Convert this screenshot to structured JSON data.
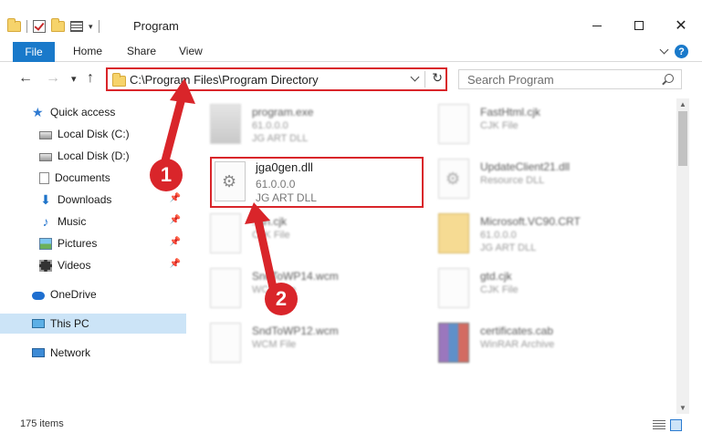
{
  "window": {
    "title": "Program",
    "controls": {
      "minimize": "",
      "maximize": "",
      "close": "✕"
    }
  },
  "ribbon": {
    "tabs": [
      {
        "label": "File"
      },
      {
        "label": "Home"
      },
      {
        "label": "Share"
      },
      {
        "label": "View"
      }
    ],
    "help": "?"
  },
  "nav": {
    "back": "←",
    "forward": "→",
    "recent": "▾",
    "up": "↑",
    "address": "C:\\Program Files\\Program Directory",
    "refresh": "↻",
    "search_placeholder": "Search Program"
  },
  "sidebar": {
    "items": [
      {
        "label": "Quick access",
        "icon": "star-icon"
      },
      {
        "label": "Local Disk (C:)",
        "icon": "disk-icon"
      },
      {
        "label": "Local Disk (D:)",
        "icon": "disk-icon"
      },
      {
        "label": "Documents",
        "icon": "documents-icon",
        "pinned": true
      },
      {
        "label": "Downloads",
        "icon": "downloads-icon",
        "pinned": true
      },
      {
        "label": "Music",
        "icon": "music-icon",
        "pinned": true
      },
      {
        "label": "Pictures",
        "icon": "pictures-icon",
        "pinned": true
      },
      {
        "label": "Videos",
        "icon": "videos-icon",
        "pinned": true
      },
      {
        "label": "OneDrive",
        "icon": "onedrive-icon"
      },
      {
        "label": "This PC",
        "icon": "this-pc-icon",
        "selected": true
      },
      {
        "label": "Network",
        "icon": "network-icon"
      }
    ],
    "pin_glyph": "📌"
  },
  "files": [
    {
      "name": "program.exe",
      "meta1": "61.0.0.0",
      "meta2": "JG ART DLL",
      "type": "exe"
    },
    {
      "name": "FastHtml.cjk",
      "meta1": "CJK File",
      "meta2": "",
      "type": "doc"
    },
    {
      "name": "UpdateClient21.dll",
      "meta1": "Resource DLL",
      "meta2": "",
      "type": "dll"
    },
    {
      "name": "..an.cjk",
      "meta1": "CJK File",
      "meta2": "",
      "type": "doc"
    },
    {
      "name": "Microsoft.VC90.CRT",
      "meta1": "61.0.0.0",
      "meta2": "JG ART DLL",
      "type": "crt"
    },
    {
      "name": "SndToWP14.wcm",
      "meta1": "WCM File",
      "meta2": "",
      "type": "doc"
    },
    {
      "name": "gtd.cjk",
      "meta1": "CJK File",
      "meta2": "",
      "type": "doc"
    },
    {
      "name": "SndToWP12.wcm",
      "meta1": "WCM File",
      "meta2": "",
      "type": "doc"
    },
    {
      "name": "certificates.cab",
      "meta1": "WinRAR Archive",
      "meta2": "",
      "type": "cab"
    }
  ],
  "highlighted_file": {
    "name": "jga0gen.dll",
    "version": "61.0.0.0",
    "description": "JG ART DLL"
  },
  "callouts": [
    "1",
    "2"
  ],
  "status": {
    "items_count": "175 items"
  },
  "colors": {
    "accent": "#1979ca",
    "highlight": "#d9252a",
    "selected": "#cce4f7"
  }
}
